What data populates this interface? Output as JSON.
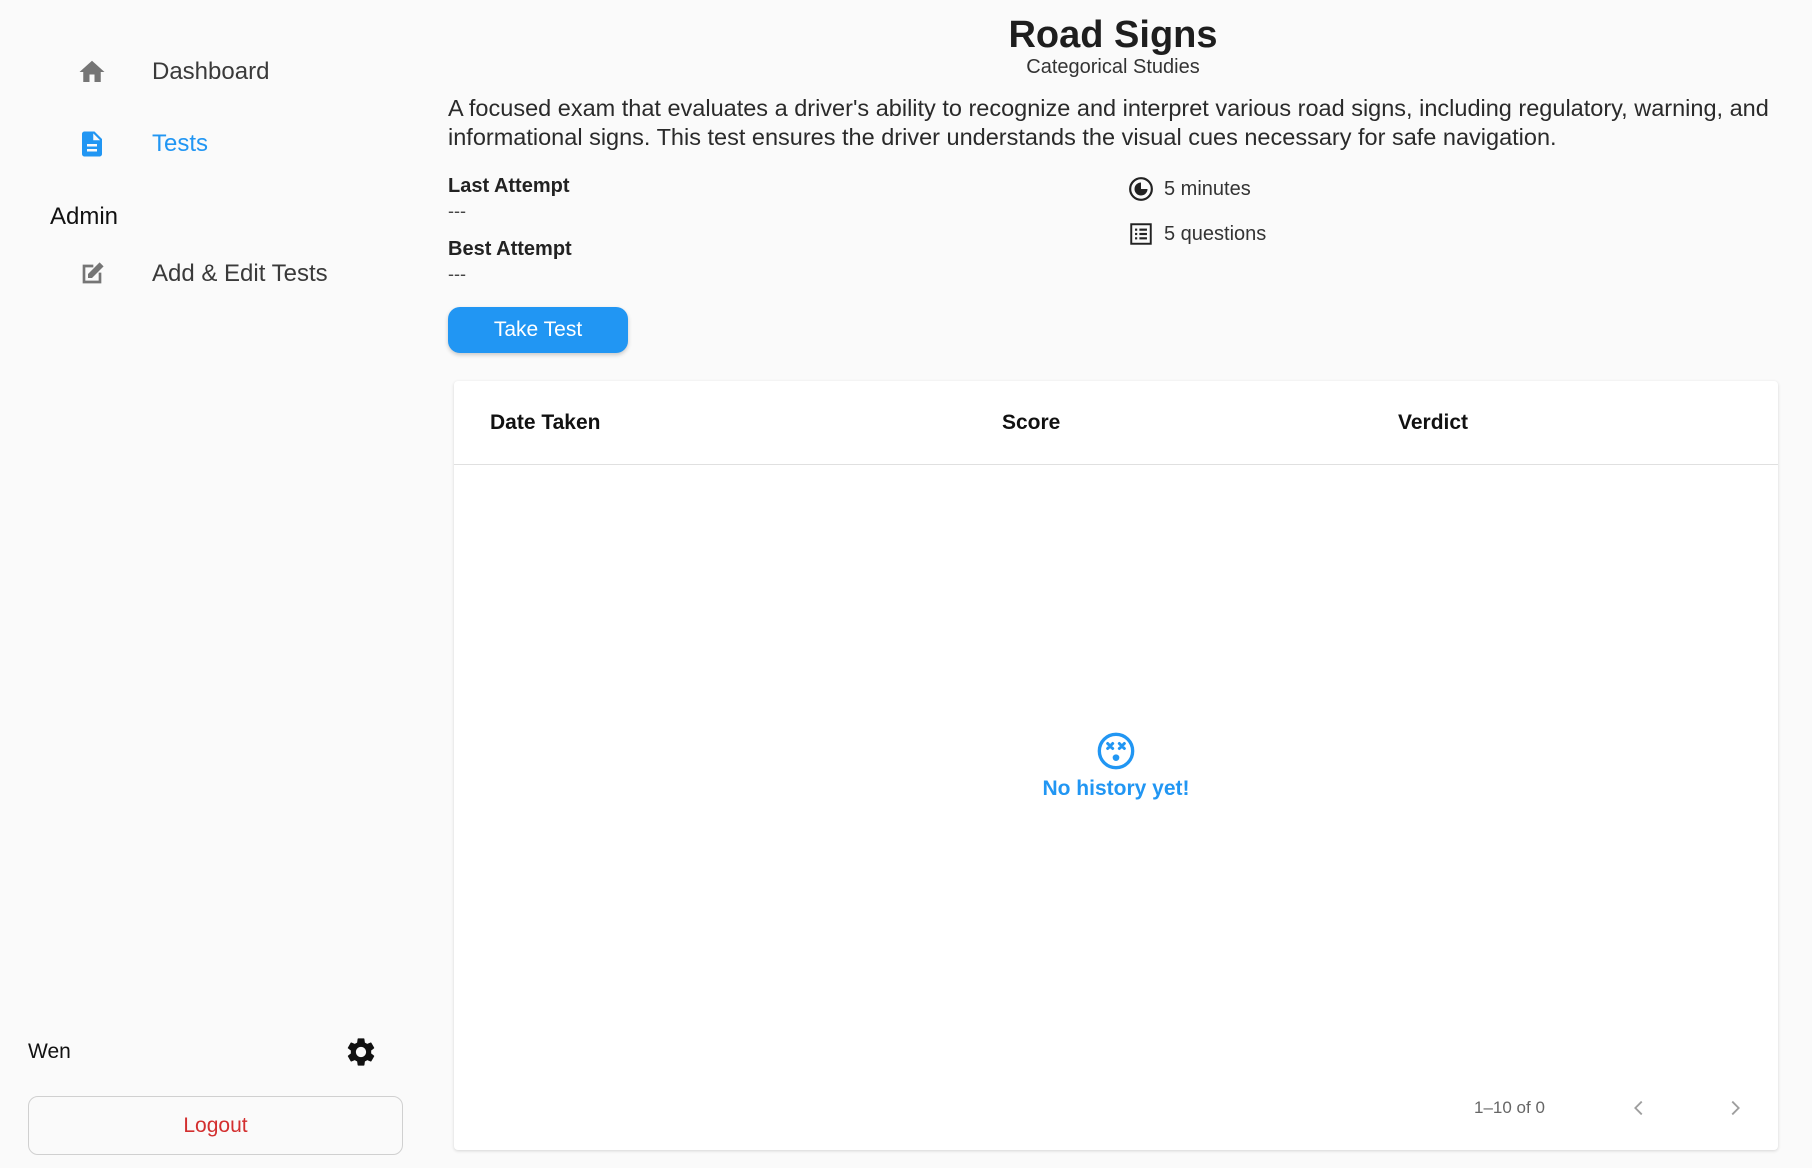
{
  "sidebar": {
    "items": [
      {
        "label": "Dashboard",
        "icon": "home-icon",
        "active": false
      },
      {
        "label": "Tests",
        "icon": "document-icon",
        "active": true
      }
    ],
    "admin_section": {
      "title": "Admin",
      "items": [
        {
          "label": "Add & Edit Tests",
          "icon": "edit-icon"
        }
      ]
    },
    "user": {
      "name": "Wen"
    },
    "logout_label": "Logout"
  },
  "test": {
    "title": "Road Signs",
    "category": "Categorical Studies",
    "description": "A focused exam that evaluates a driver's ability to recognize and interpret various road signs, including regulatory, warning, and informational signs. This test ensures the driver understands the visual cues necessary for safe navigation.",
    "last_attempt_label": "Last Attempt",
    "last_attempt_value": "---",
    "best_attempt_label": "Best Attempt",
    "best_attempt_value": "---",
    "duration": "5 minutes",
    "questions": "5 questions",
    "take_test_label": "Take Test"
  },
  "history_table": {
    "columns": [
      "Date Taken",
      "Score",
      "Verdict"
    ],
    "rows": [],
    "empty_message": "No history yet!",
    "pagination": "1–10 of 0"
  },
  "colors": {
    "accent": "#2196f3",
    "logout": "#d32f2f",
    "background": "#fafafa"
  }
}
